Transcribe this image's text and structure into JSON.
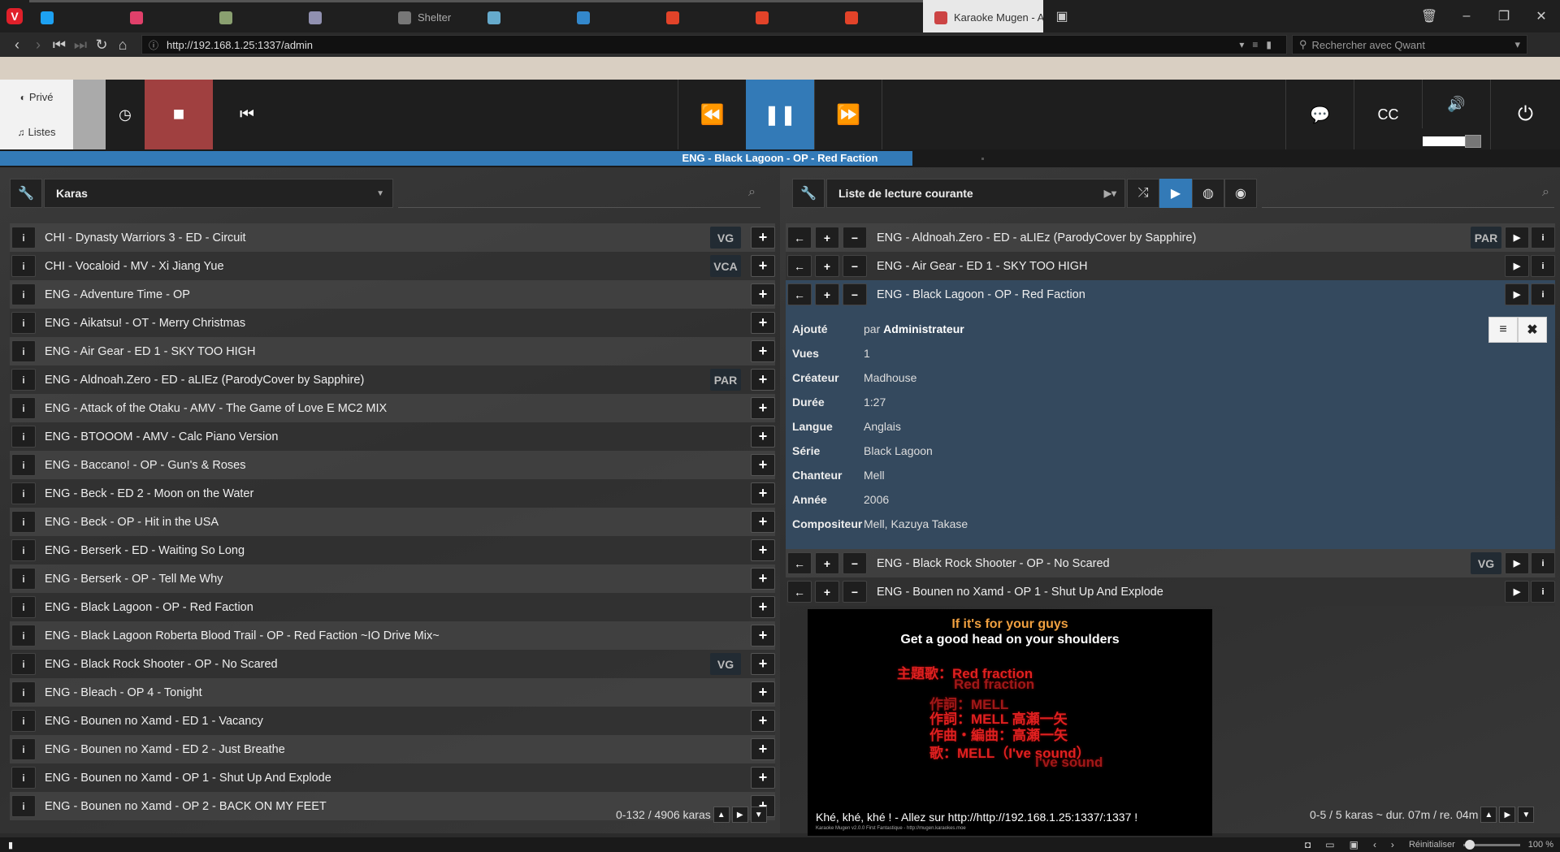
{
  "browser": {
    "tabs": [
      {
        "label": "",
        "color": "#1da1f2"
      },
      {
        "label": "",
        "color": "#e0406a"
      },
      {
        "label": "",
        "color": "#8aa070"
      },
      {
        "label": "",
        "color": "#9090b0"
      },
      {
        "label": "Shelter",
        "color": "#777777"
      },
      {
        "label": "",
        "color": "#66aacc"
      },
      {
        "label": "",
        "color": "#3388cc"
      },
      {
        "label": "",
        "color": "#e24329"
      },
      {
        "label": "",
        "color": "#e24329"
      },
      {
        "label": "",
        "color": "#e24329"
      }
    ],
    "active_tab": "Karaoke Mugen - ADM",
    "url": "http://192.168.1.25:1337/admin",
    "search_placeholder": "Rechercher avec Qwant"
  },
  "sidebar": {
    "prive": "Privé",
    "listes": "Listes"
  },
  "player": {
    "now_playing": "ENG - Black Lagoon - OP - Red Faction",
    "progress": 0.585,
    "volume": 0.95
  },
  "left_panel": {
    "selector": "Karas",
    "counter": "0-132 / 4906 karas",
    "items": [
      {
        "title": "CHI - Dynasty Warriors 3 - ED - Circuit",
        "tag": "VG"
      },
      {
        "title": "CHI - Vocaloid - MV - Xi Jiang Yue",
        "tag": "VCA"
      },
      {
        "title": "ENG - Adventure Time - OP",
        "tag": ""
      },
      {
        "title": "ENG - Aikatsu! - OT - Merry Christmas",
        "tag": ""
      },
      {
        "title": "ENG - Air Gear - ED 1 - SKY TOO HIGH",
        "tag": ""
      },
      {
        "title": "ENG - Aldnoah.Zero - ED - aLIEz (ParodyCover by Sapphire)",
        "tag": "PAR"
      },
      {
        "title": "ENG - Attack of the Otaku - AMV - The Game of Love E MC2 MIX",
        "tag": ""
      },
      {
        "title": "ENG - BTOOOM - AMV - Calc Piano Version",
        "tag": ""
      },
      {
        "title": "ENG - Baccano! - OP - Gun's & Roses",
        "tag": ""
      },
      {
        "title": "ENG - Beck - ED 2 - Moon on the Water",
        "tag": ""
      },
      {
        "title": "ENG - Beck - OP - Hit in the USA",
        "tag": ""
      },
      {
        "title": "ENG - Berserk - ED - Waiting So Long",
        "tag": ""
      },
      {
        "title": "ENG - Berserk - OP - Tell Me Why",
        "tag": ""
      },
      {
        "title": "ENG - Black Lagoon - OP - Red Faction",
        "tag": ""
      },
      {
        "title": "ENG - Black Lagoon Roberta Blood Trail - OP - Red Faction ~IO Drive Mix~",
        "tag": ""
      },
      {
        "title": "ENG - Black Rock Shooter - OP - No Scared",
        "tag": "VG"
      },
      {
        "title": "ENG - Bleach - OP 4 - Tonight",
        "tag": ""
      },
      {
        "title": "ENG - Bounen no Xamd - ED 1 - Vacancy",
        "tag": ""
      },
      {
        "title": "ENG - Bounen no Xamd - ED 2 - Just Breathe",
        "tag": ""
      },
      {
        "title": "ENG - Bounen no Xamd - OP 1 - Shut Up And Explode",
        "tag": ""
      },
      {
        "title": "ENG - Bounen no Xamd - OP 2 - BACK ON MY FEET",
        "tag": ""
      }
    ]
  },
  "right_panel": {
    "selector": "Liste de lecture courante",
    "counter": "0-5 / 5 karas ~ dur. 07m / re. 04m",
    "items": [
      {
        "title": "ENG - Aldnoah.Zero - ED - aLIEz (ParodyCover by Sapphire)",
        "tag": "PAR"
      },
      {
        "title": "ENG - Air Gear - ED 1 - SKY TOO HIGH",
        "tag": ""
      },
      {
        "title": "ENG - Black Lagoon - OP - Red Faction",
        "tag": ""
      }
    ],
    "items_after": [
      {
        "title": "ENG - Black Rock Shooter - OP - No Scared",
        "tag": "VG"
      },
      {
        "title": "ENG - Bounen no Xamd - OP 1 - Shut Up And Explode",
        "tag": ""
      }
    ],
    "details": {
      "ajoute_label": "Ajouté",
      "ajoute_prefix": "par",
      "ajoute_value": "Administrateur",
      "vues_label": "Vues",
      "vues_value": "1",
      "createur_label": "Créateur",
      "createur_value": "Madhouse",
      "duree_label": "Durée",
      "duree_value": "1:27",
      "langue_label": "Langue",
      "langue_value": "Anglais",
      "serie_label": "Série",
      "serie_value": "Black Lagoon",
      "chanteur_label": "Chanteur",
      "chanteur_value": "Mell",
      "annee_label": "Année",
      "annee_value": "2006",
      "compositeur_label": "Compositeur",
      "compositeur_value": "Mell, Kazuya Takase"
    }
  },
  "video": {
    "line1": "If it's for your guys",
    "line2": "Get a good head on your shoulders",
    "credits": [
      "主題歌：Red fraction",
      "Red fraction",
      "作詞：MELL",
      "作詞：MELL 高瀬一矢",
      "作曲・編曲：高瀬一矢",
      "歌：MELL（I've sound）",
      "I've sound"
    ],
    "bottom_text": "Khé, khé, khé ! - Allez sur http://http://192.168.1.25:1337/:1337 !",
    "tiny_text": "Karaoke Mugen v2.0.0 First Fantastique - http://mugen.karaokes.moe"
  },
  "statusbar": {
    "reset_label": "Réinitialiser",
    "zoom": "100 %"
  }
}
